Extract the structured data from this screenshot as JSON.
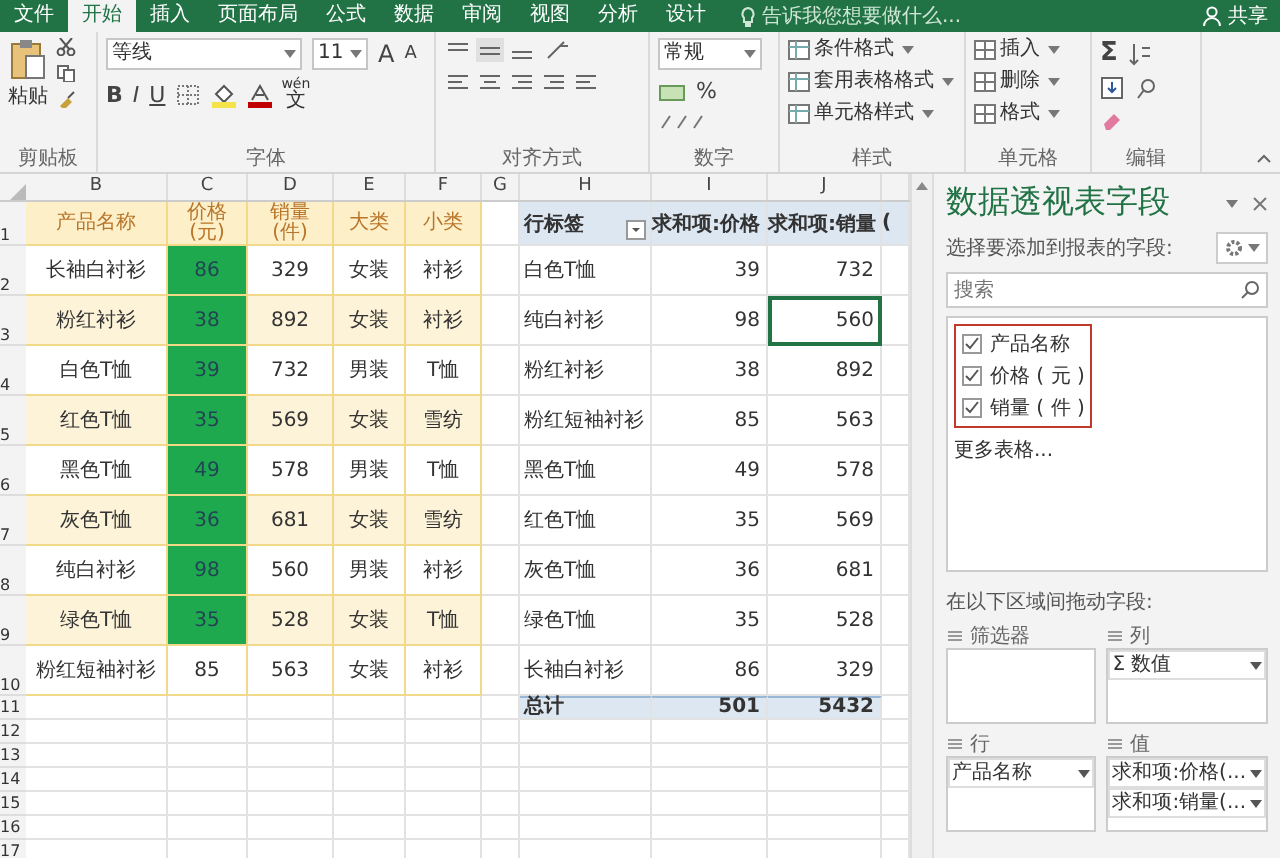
{
  "tabs": [
    {
      "label": "文件",
      "selected": false
    },
    {
      "label": "开始",
      "selected": true
    },
    {
      "label": "插入",
      "selected": false
    },
    {
      "label": "页面布局",
      "selected": false
    },
    {
      "label": "公式",
      "selected": false
    },
    {
      "label": "数据",
      "selected": false
    },
    {
      "label": "审阅",
      "selected": false
    },
    {
      "label": "视图",
      "selected": false
    },
    {
      "label": "分析",
      "selected": false
    },
    {
      "label": "设计",
      "selected": false
    }
  ],
  "tell_me": {
    "placeholder": "告诉我您想要做什么..."
  },
  "share": "共享",
  "ribbon": {
    "clipboard": {
      "paste": "粘贴",
      "label": "剪贴板"
    },
    "font": {
      "name": "等线",
      "size": "11",
      "grow": "A",
      "shrink": "A",
      "bold": "B",
      "italic": "I",
      "underline": "U",
      "phonetic_top": "wén",
      "phonetic_bottom": "文",
      "label": "字体"
    },
    "alignment": {
      "label": "对齐方式"
    },
    "number": {
      "format": "常规",
      "percent": "%",
      "label": "数字"
    },
    "styles": {
      "items": [
        "条件格式",
        "套用表格格式",
        "单元格样式"
      ],
      "label": "样式"
    },
    "cells": {
      "items": [
        "插入",
        "删除",
        "格式"
      ],
      "label": "单元格"
    },
    "editing": {
      "sum": "Σ",
      "label": "编辑"
    }
  },
  "sheet": {
    "columns": [
      "B",
      "C",
      "D",
      "E",
      "F",
      "G",
      "H",
      "I",
      "J",
      ""
    ],
    "row_numbers": [
      "1",
      "2",
      "3",
      "4",
      "5",
      "6",
      "7",
      "8",
      "9",
      "10",
      "11",
      "12",
      "13",
      "14",
      "15",
      "16",
      "17"
    ]
  },
  "data_table": {
    "header": [
      "产品名称",
      "价格\n(元)",
      "销量\n(件)",
      "大类",
      "小类"
    ],
    "rows": [
      {
        "name": "长袖白衬衫",
        "price": "86",
        "sales": "329",
        "category": "女装",
        "subcategory": "衬衫",
        "highlighted": true
      },
      {
        "name": "粉红衬衫",
        "price": "38",
        "sales": "892",
        "category": "女装",
        "subcategory": "衬衫",
        "highlighted": true
      },
      {
        "name": "白色T恤",
        "price": "39",
        "sales": "732",
        "category": "男装",
        "subcategory": "T恤",
        "highlighted": true
      },
      {
        "name": "红色T恤",
        "price": "35",
        "sales": "569",
        "category": "女装",
        "subcategory": "雪纺",
        "highlighted": true
      },
      {
        "name": "黑色T恤",
        "price": "49",
        "sales": "578",
        "category": "男装",
        "subcategory": "T恤",
        "highlighted": true
      },
      {
        "name": "灰色T恤",
        "price": "36",
        "sales": "681",
        "category": "女装",
        "subcategory": "雪纺",
        "highlighted": true
      },
      {
        "name": "纯白衬衫",
        "price": "98",
        "sales": "560",
        "category": "男装",
        "subcategory": "衬衫",
        "highlighted": true
      },
      {
        "name": "绿色T恤",
        "price": "35",
        "sales": "528",
        "category": "女装",
        "subcategory": "T恤",
        "highlighted": true
      },
      {
        "name": "粉红短袖衬衫",
        "price": "85",
        "sales": "563",
        "category": "女装",
        "subcategory": "衬衫",
        "highlighted": false
      }
    ]
  },
  "pivot": {
    "header": {
      "row_label": "行标签",
      "price": "求和项:价格",
      "sales": "求和项:销量",
      "column_4": "("
    },
    "rows": [
      {
        "label": "白色T恤",
        "price": "39",
        "sales": "732",
        "selected": false
      },
      {
        "label": "纯白衬衫",
        "price": "98",
        "sales": "560",
        "selected": true
      },
      {
        "label": "粉红衬衫",
        "price": "38",
        "sales": "892",
        "selected": false
      },
      {
        "label": "粉红短袖衬衫",
        "price": "85",
        "sales": "563",
        "selected": false
      },
      {
        "label": "黑色T恤",
        "price": "49",
        "sales": "578",
        "selected": false
      },
      {
        "label": "红色T恤",
        "price": "35",
        "sales": "569",
        "selected": false
      },
      {
        "label": "灰色T恤",
        "price": "36",
        "sales": "681",
        "selected": false
      },
      {
        "label": "绿色T恤",
        "price": "35",
        "sales": "528",
        "selected": false
      },
      {
        "label": "长袖白衬衫",
        "price": "86",
        "sales": "329",
        "selected": false
      }
    ],
    "total": {
      "label": "总计",
      "price": "501",
      "sales": "5432"
    }
  },
  "field_pane": {
    "title": "数据透视表字段",
    "subtitle": "选择要添加到报表的字段:",
    "search": {
      "placeholder": "搜索"
    },
    "fields_outlined": true,
    "fields": [
      {
        "label": "产品名称",
        "checked": true
      },
      {
        "label": "价格 ( 元 )",
        "checked": true
      },
      {
        "label": "销量 ( 件 )",
        "checked": true
      }
    ],
    "more_tables": "更多表格...",
    "areas_hint": "在以下区域间拖动字段:",
    "areas": [
      {
        "label": "筛选器"
      },
      {
        "label": "列",
        "items": [
          "Σ 数值"
        ]
      },
      {
        "label": "行",
        "items": [
          "产品名称"
        ]
      },
      {
        "label": "值",
        "items": [
          "求和项:价格(...",
          "求和项:销量(..."
        ]
      }
    ]
  }
}
